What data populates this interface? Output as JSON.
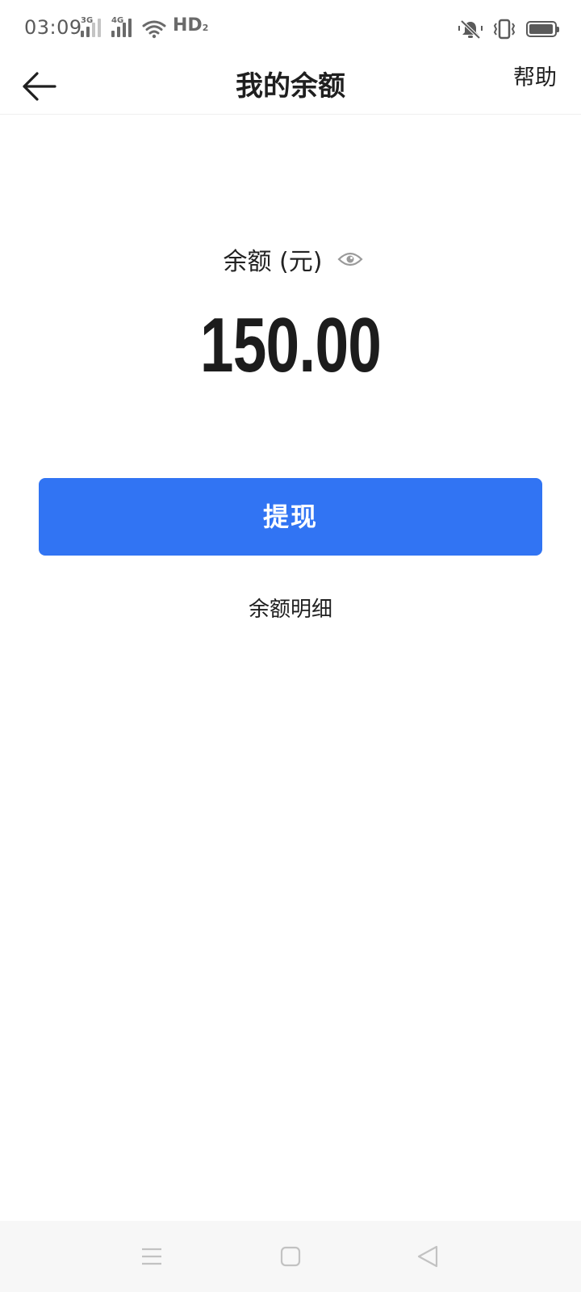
{
  "status_bar": {
    "time": "03:09",
    "network_1": "3G",
    "network_2": "4G",
    "hd_label": "HD",
    "hd_sub": "2",
    "battery_level": 0.95,
    "icons": [
      "signal-3g-icon",
      "signal-4g-icon",
      "wifi-icon",
      "hd-icon",
      "vibrate-mute-icon",
      "vibrate-icon",
      "battery-icon"
    ]
  },
  "header": {
    "title": "我的余额",
    "help_label": "帮助",
    "back_icon": "back-arrow-icon"
  },
  "balance": {
    "label": "余额 (元)",
    "amount": "150.00",
    "visibility_icon": "eye-icon"
  },
  "actions": {
    "withdraw_label": "提现",
    "detail_label": "余额明细"
  },
  "colors": {
    "accent": "#3174f3",
    "text": "#1f1f1f",
    "nav_bg": "#f7f7f7"
  },
  "nav_bar": {
    "icons": [
      "menu-icon",
      "home-square-icon",
      "back-triangle-icon"
    ]
  }
}
